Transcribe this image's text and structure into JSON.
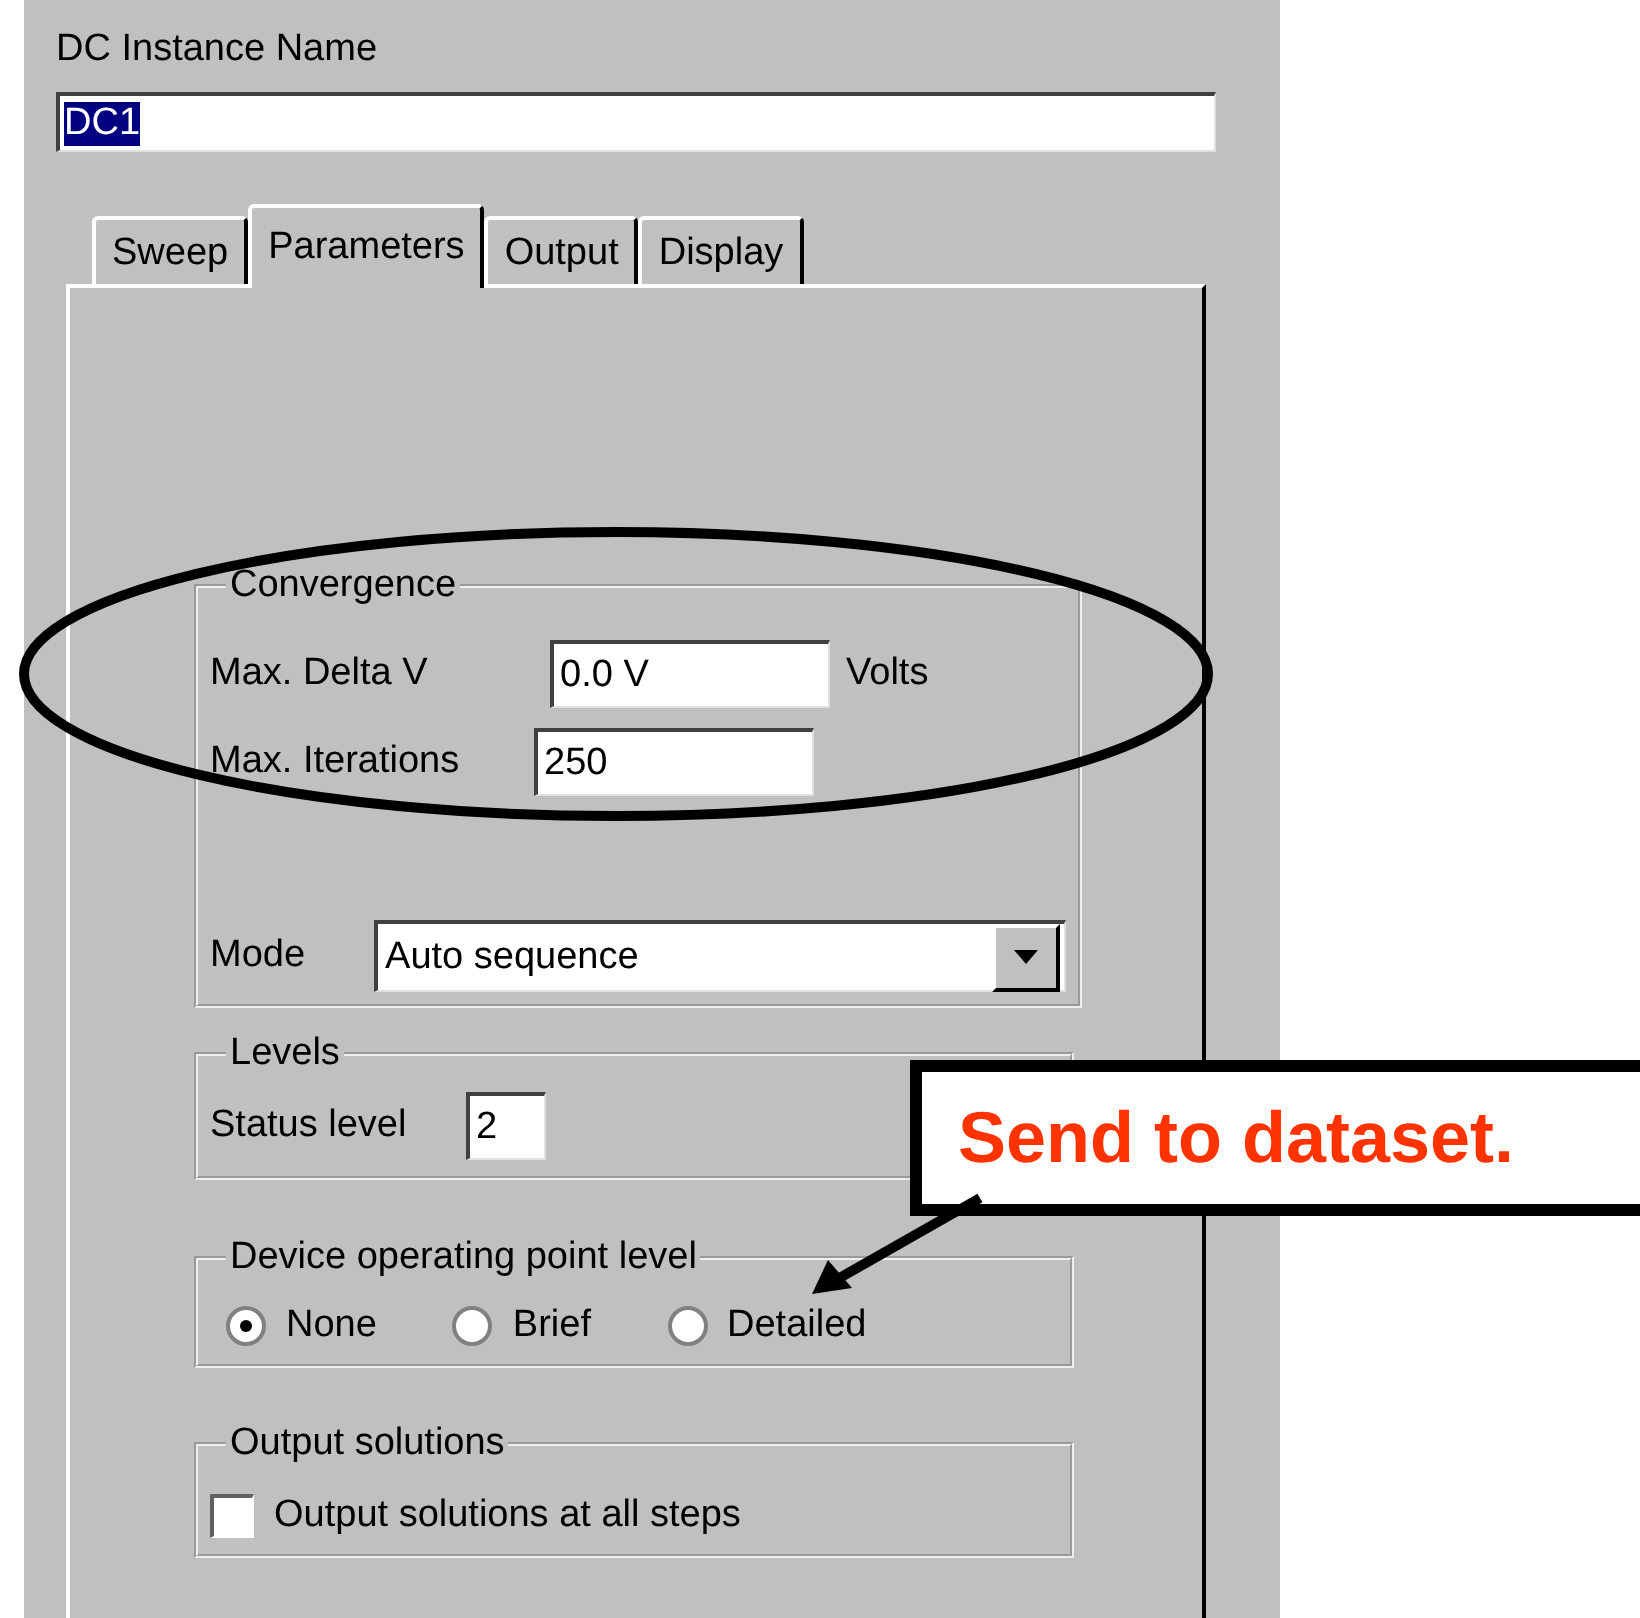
{
  "instance_name": {
    "label": "DC Instance Name",
    "value": "DC1"
  },
  "tabs": [
    {
      "label": "Sweep",
      "selected": false
    },
    {
      "label": "Parameters",
      "selected": true
    },
    {
      "label": "Output",
      "selected": false
    },
    {
      "label": "Display",
      "selected": false
    }
  ],
  "convergence": {
    "title": "Convergence",
    "max_delta_v": {
      "label": "Max. Delta V",
      "value": "0.0 V",
      "unit": "Volts"
    },
    "max_iterations": {
      "label": "Max. Iterations",
      "value": "250"
    },
    "mode": {
      "label": "Mode",
      "value": "Auto sequence"
    }
  },
  "levels": {
    "title": "Levels",
    "status_level": {
      "label": "Status level",
      "value": "2"
    }
  },
  "device_operating_point_level": {
    "title": "Device operating point level",
    "options": [
      {
        "label": "None",
        "selected": true
      },
      {
        "label": "Brief",
        "selected": false
      },
      {
        "label": "Detailed",
        "selected": false
      }
    ]
  },
  "output_solutions": {
    "title": "Output solutions",
    "checkbox": {
      "label": "Output solutions at all steps",
      "checked": false
    }
  },
  "annotation": {
    "callout": "Send to dataset."
  }
}
